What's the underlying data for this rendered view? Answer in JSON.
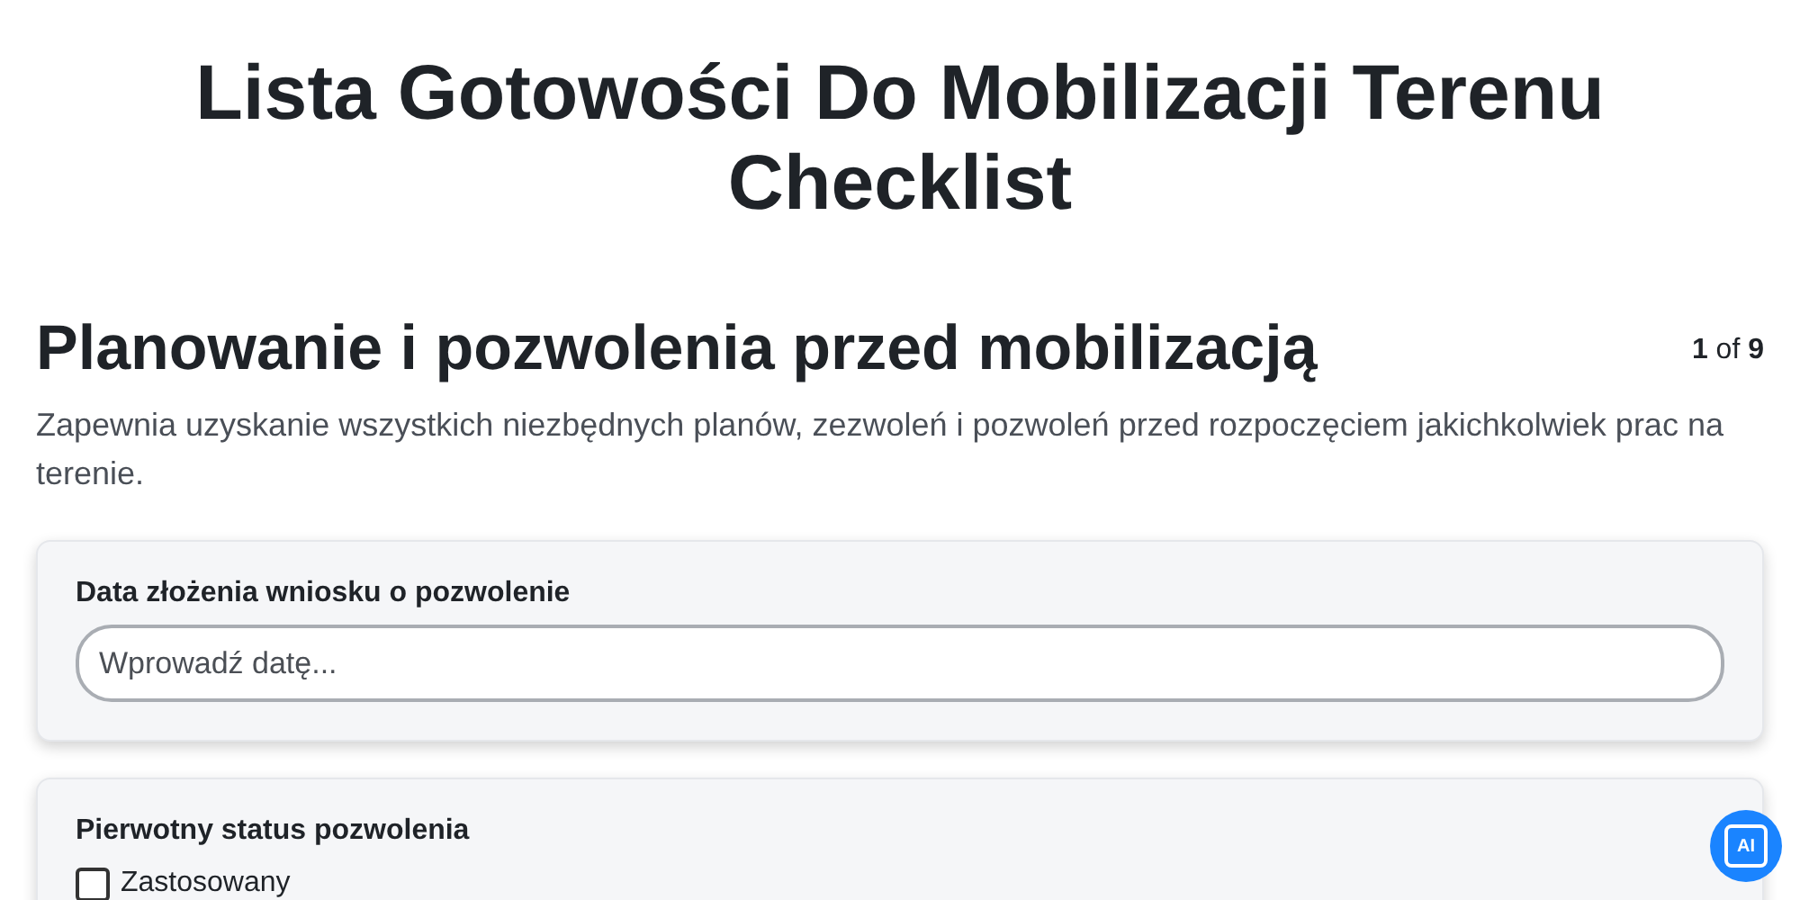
{
  "title": "Lista Gotowości Do Mobilizacji Terenu Checklist",
  "section": {
    "heading": "Planowanie i pozwolenia przed mobilizacją",
    "counter": "**1** of **9**",
    "description": "Zapewnia uzyskanie wszystkich niezbędnych planów, zezwoleń i pozwoleń przed rozpoczęciem jakichkolwiek prac na terenie."
  },
  "questions": [
    {
      "kind": "date",
      "label": "Data złożenia wniosku o pozwolenie",
      "placeholder": "Wprowadź datę..."
    },
    {
      "kind": "checkboxes",
      "label": "Pierwotny status pozwolenia",
      "options": [
        {
          "label": "Zastosowany",
          "checked": false
        }
      ]
    }
  ],
  "assistant_button": {
    "label": "AI"
  }
}
